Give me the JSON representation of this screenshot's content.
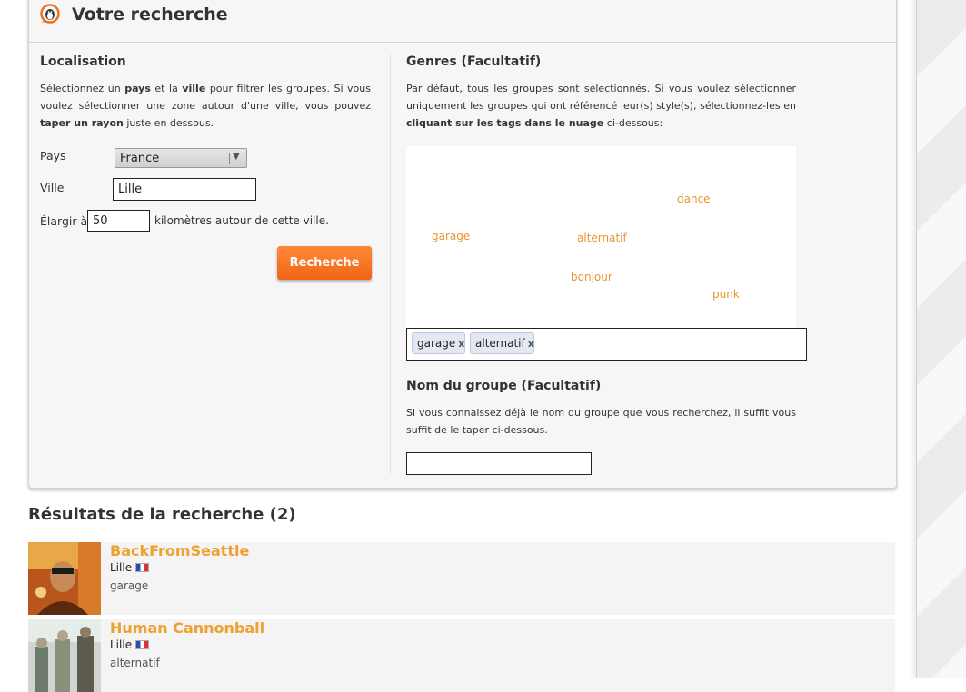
{
  "panel": {
    "title": "Votre recherche"
  },
  "location": {
    "title": "Localisation",
    "help": [
      {
        "t": "Sélectionnez un ",
        "b": false
      },
      {
        "t": "pays",
        "b": true
      },
      {
        "t": " et la ",
        "b": false
      },
      {
        "t": "ville",
        "b": true
      },
      {
        "t": " pour filtrer les groupes. Si vous voulez sélectionner une zone autour d'une ville, vous pouvez ",
        "b": false
      },
      {
        "t": "taper un rayon",
        "b": true
      },
      {
        "t": " juste en dessous.",
        "b": false
      }
    ],
    "country_label": "Pays",
    "country_value": "France",
    "city_label": "Ville",
    "city_value": "Lille",
    "radius_prefix": "Élargir à",
    "radius_value": "50",
    "radius_suffix": "kilomètres autour de cette ville.",
    "search_button": "Recherche"
  },
  "genres": {
    "title": "Genres (Facultatif)",
    "help": [
      {
        "t": "Par défaut, tous les groupes sont sélectionnés. Si vous voulez sélectionner uniquement les groupes qui ont référencé leur(s) style(s), sélectionnez-les en ",
        "b": false
      },
      {
        "t": "cliquant sur les tags dans le nuage",
        "b": true
      },
      {
        "t": " ci-dessous:",
        "b": false
      }
    ],
    "cloud": [
      "dance",
      "garage",
      "alternatif",
      "bonjour",
      "punk"
    ],
    "selected": [
      "garage",
      "alternatif"
    ],
    "remove_symbol": "x",
    "accent_color": "#e8962f"
  },
  "group_name": {
    "title": "Nom du groupe (Facultatif)",
    "help": "Si vous connaissez déjà le nom du groupe que vous recherchez, il suffit vous suffit de le taper ci-dessous.",
    "value": ""
  },
  "results": {
    "title": "Résultats de la recherche (2)",
    "items": [
      {
        "name": "BackFromSeattle",
        "city": "Lille",
        "genre": "garage"
      },
      {
        "name": "Human Cannonball",
        "city": "Lille",
        "genre": "alternatif"
      }
    ],
    "name_color": "#f0a030"
  }
}
